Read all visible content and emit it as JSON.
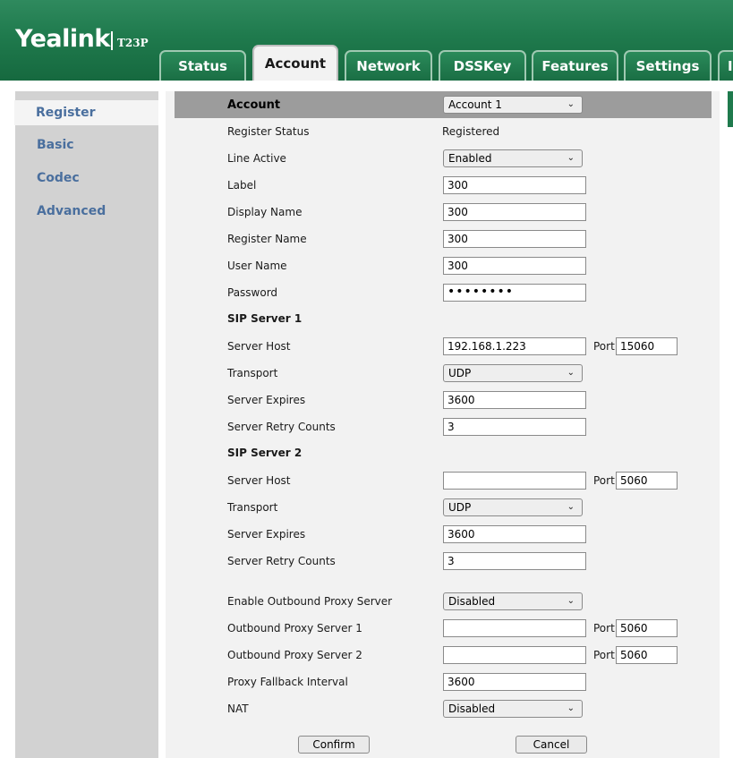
{
  "brand": {
    "logo": "Yealink",
    "model": "T23P"
  },
  "tabs": [
    "Status",
    "Account",
    "Network",
    "DSSKey",
    "Features",
    "Settings",
    "I"
  ],
  "active_tab": "Account",
  "sidebar": {
    "items": [
      "Register",
      "Basic",
      "Codec",
      "Advanced"
    ],
    "active": "Register"
  },
  "form": {
    "account_label": "Account",
    "account_value": "Account 1",
    "register_status_label": "Register Status",
    "register_status_value": "Registered",
    "line_active_label": "Line Active",
    "line_active_value": "Enabled",
    "label_label": "Label",
    "label_value": "300",
    "display_name_label": "Display Name",
    "display_name_value": "300",
    "register_name_label": "Register Name",
    "register_name_value": "300",
    "user_name_label": "User Name",
    "user_name_value": "300",
    "password_label": "Password",
    "password_value": "••••••••",
    "sip1": {
      "title": "SIP Server 1",
      "host_label": "Server Host",
      "host_value": "192.168.1.223",
      "port_label": "Port",
      "port_value": "15060",
      "transport_label": "Transport",
      "transport_value": "UDP",
      "expires_label": "Server Expires",
      "expires_value": "3600",
      "retry_label": "Server Retry Counts",
      "retry_value": "3"
    },
    "sip2": {
      "title": "SIP Server 2",
      "host_label": "Server Host",
      "host_value": "",
      "port_label": "Port",
      "port_value": "5060",
      "transport_label": "Transport",
      "transport_value": "UDP",
      "expires_label": "Server Expires",
      "expires_value": "3600",
      "retry_label": "Server Retry Counts",
      "retry_value": "3"
    },
    "outbound_enable_label": "Enable Outbound Proxy Server",
    "outbound_enable_value": "Disabled",
    "proxy1_label": "Outbound Proxy Server 1",
    "proxy1_value": "",
    "proxy1_port_label": "Port",
    "proxy1_port_value": "5060",
    "proxy2_label": "Outbound Proxy Server 2",
    "proxy2_value": "",
    "proxy2_port_label": "Port",
    "proxy2_port_value": "5060",
    "fallback_label": "Proxy Fallback Interval",
    "fallback_value": "3600",
    "nat_label": "NAT",
    "nat_value": "Disabled"
  },
  "buttons": {
    "confirm": "Confirm",
    "cancel": "Cancel"
  },
  "colors": {
    "header_green": "#1f7a4d",
    "sidebar_text": "#4a6f9e",
    "header_bar": "#9c9c9c"
  }
}
